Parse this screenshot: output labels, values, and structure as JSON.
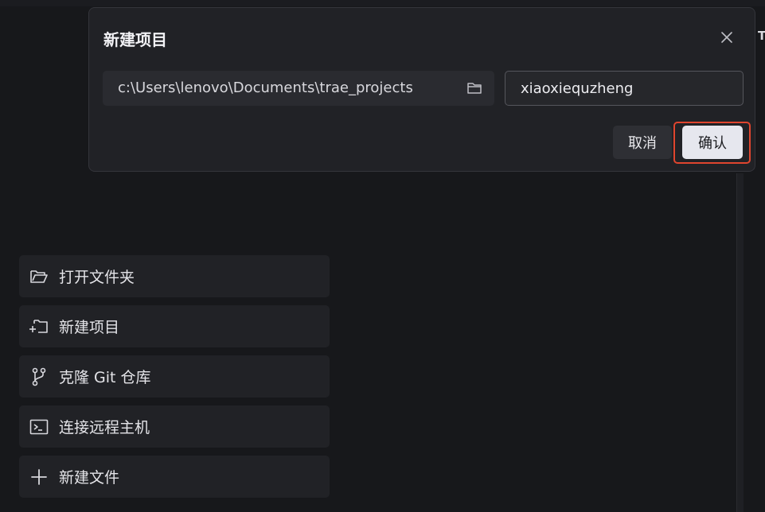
{
  "dialog": {
    "title": "新建项目",
    "path_value": "c:\\Users\\lenovo\\Documents\\trae_projects",
    "project_name_value": "xiaoxiequzheng",
    "cancel_label": "取消",
    "confirm_label": "确认"
  },
  "welcome": {
    "actions": [
      {
        "label": "打开文件夹",
        "icon": "folder-open-icon"
      },
      {
        "label": "新建项目",
        "icon": "new-project-icon"
      },
      {
        "label": "克隆 Git 仓库",
        "icon": "git-branch-icon"
      },
      {
        "label": "连接远程主机",
        "icon": "terminal-icon"
      },
      {
        "label": "新建文件",
        "icon": "plus-icon"
      }
    ]
  },
  "clipped_text": "T",
  "colors": {
    "background": "#17181b",
    "dialog_bg": "#212226",
    "highlight": "#e0452e",
    "confirm_bg": "#e6e7ee"
  }
}
